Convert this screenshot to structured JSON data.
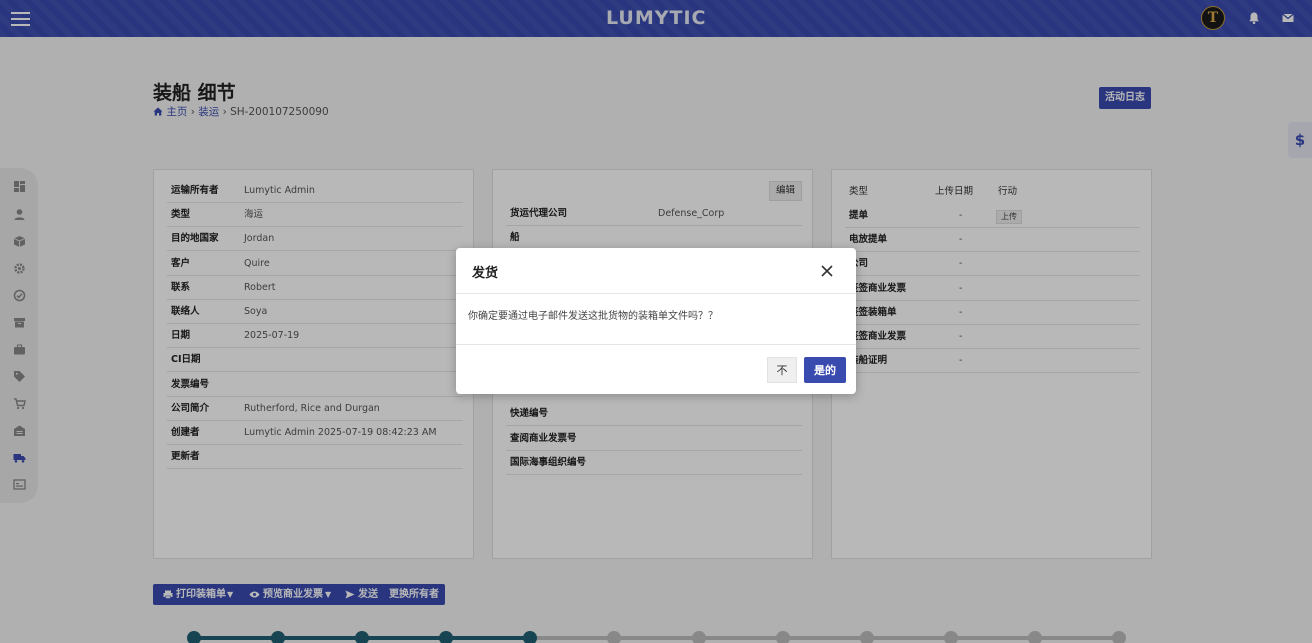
{
  "header": {
    "logo": "LUMYTIC",
    "avatar_letter": "T"
  },
  "page": {
    "title": "装船 细节",
    "breadcrumb": {
      "home": "主页",
      "section": "装运",
      "current": "SH-200107250090"
    },
    "activity_log": "活动日志",
    "dollar": "$"
  },
  "card1": {
    "rows": [
      {
        "label": "运输所有者",
        "value": "Lumytic Admin"
      },
      {
        "label": "类型",
        "value": "海运"
      },
      {
        "label": "目的地国家",
        "value": "Jordan"
      },
      {
        "label": "客户",
        "value": "Quire"
      },
      {
        "label": "联系",
        "value": "Robert"
      },
      {
        "label": "联络人",
        "value": "Soya"
      },
      {
        "label": "日期",
        "value": "2025-07-19"
      },
      {
        "label": "CI日期",
        "value": ""
      },
      {
        "label": "发票编号",
        "value": ""
      },
      {
        "label": "公司简介",
        "value": "Rutherford, Rice and Durgan"
      },
      {
        "label": "创建者",
        "value": "Lumytic Admin 2025-07-19 08:42:23 AM"
      },
      {
        "label": "更新者",
        "value": ""
      }
    ]
  },
  "card2": {
    "edit": "编辑",
    "rows_top": [
      {
        "label": "货运代理公司",
        "value": "Defense_Corp"
      },
      {
        "label": "船",
        "value": ""
      }
    ],
    "rows_bottom": [
      {
        "label": "快递编号",
        "value": ""
      },
      {
        "label": "查阅商业发票号",
        "value": ""
      },
      {
        "label": "国际海事组织编号",
        "value": ""
      }
    ]
  },
  "card3": {
    "headers": {
      "type": "类型",
      "upload_date": "上传日期",
      "action": "行动"
    },
    "upload_btn": "上传",
    "rows": [
      {
        "label": "提单",
        "date": "-"
      },
      {
        "label": "电放提单",
        "date": "-"
      },
      {
        "label": "公司",
        "date": "-"
      },
      {
        "label": "签签商业发票",
        "date": "-"
      },
      {
        "label": "签签装箱单",
        "date": "-"
      },
      {
        "label": "签签商业发票",
        "date": "-"
      },
      {
        "label": "装船证明",
        "date": "-"
      }
    ]
  },
  "actions": {
    "print_packing": "打印装箱单",
    "preview_invoice": "预览商业发票",
    "send": "发送",
    "change_owner": "更换所有者"
  },
  "progress": {
    "completed_steps": 4,
    "total_steps": 12
  },
  "modal": {
    "title": "发货",
    "message": "你确定要通过电子邮件发送这批货物的装箱单文件吗？？",
    "no": "不",
    "yes": "是的"
  },
  "colors": {
    "primary": "#3a4bb0",
    "progress_done": "#1f5f73",
    "progress_todo": "#bdbdbd"
  }
}
